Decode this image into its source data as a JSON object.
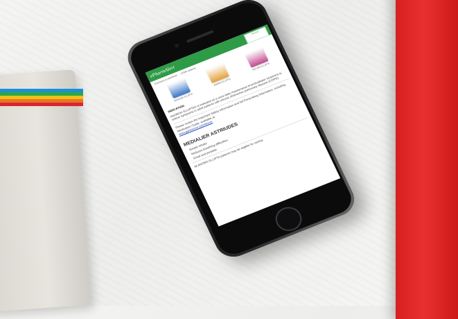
{
  "scene": {
    "table_color": "#f1f1ef",
    "notebook_stripe_colors": [
      "#1e8fd6",
      "#2aa84a",
      "#f2c014",
      "#e8732a",
      "#d9262d"
    ],
    "red_book_color": "#e02727"
  },
  "email": {
    "brand": "ePharmAlert",
    "header_color": "#2e9b46",
    "logo_label": "ROCHE",
    "intro": "Exclusive to ANORO® … COPD patients",
    "products": [
      {
        "name": "INCRUSE ELLIPTA",
        "color": "#3a77c8"
      },
      {
        "name": "ANORO ELLIPTA",
        "color": "#e2a13a"
      },
      {
        "name": "RELVAR ELLIPTA",
        "color": "#c24a8f"
      }
    ],
    "indication_heading": "INDICATION",
    "body_1": "ANORO® ELLIPTA® is indicated as a once-daily maintenance bronchodilator treatment to relieve symptoms in adult patients with chronic obstructive pulmonary disease (COPD).",
    "body_2": "Please review the Important Safety Information and full Prescribing Information, including Medication Guide, available at",
    "link": "www.gsksource.com/anoro",
    "section_title": "MEDIALIER ASTRIUDES",
    "bullets": [
      "Simple inhaler",
      "Reduces breathing difficulties",
      "Small and portable"
    ],
    "footer": "All ANORO ELLIPTA patients may be eligible for saving."
  }
}
